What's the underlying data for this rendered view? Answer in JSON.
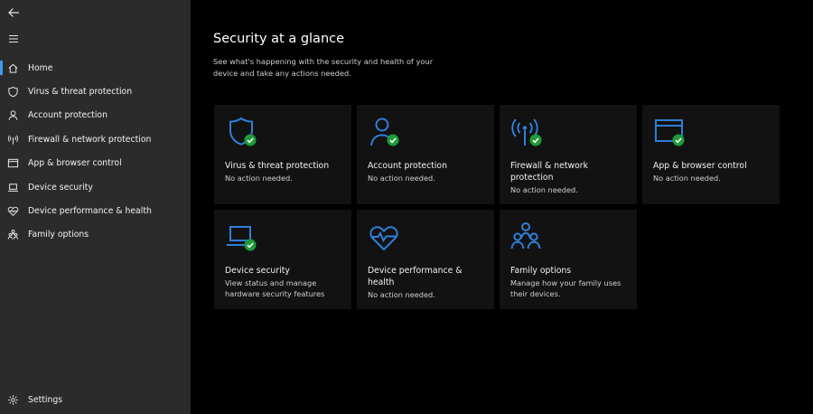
{
  "sidebar": {
    "items": [
      {
        "label": "Home",
        "icon": "home-icon",
        "active": true
      },
      {
        "label": "Virus & threat protection",
        "icon": "shield-icon"
      },
      {
        "label": "Account protection",
        "icon": "person-icon"
      },
      {
        "label": "Firewall & network protection",
        "icon": "wireless-antenna-icon"
      },
      {
        "label": "App & browser control",
        "icon": "browser-window-icon"
      },
      {
        "label": "Device security",
        "icon": "laptop-icon"
      },
      {
        "label": "Device performance & health",
        "icon": "heart-pulse-icon"
      },
      {
        "label": "Family options",
        "icon": "family-icon"
      }
    ],
    "settings_label": "Settings"
  },
  "main": {
    "title": "Security at a glance",
    "subtitle": "See what's happening with the security and health of your device and take any actions needed.",
    "tiles": [
      {
        "title": "Virus & threat protection",
        "status": "No action needed.",
        "icon": "shield-icon"
      },
      {
        "title": "Account protection",
        "status": "No action needed.",
        "icon": "person-icon"
      },
      {
        "title": "Firewall & network protection",
        "status": "No action needed.",
        "icon": "wireless-antenna-icon"
      },
      {
        "title": "App & browser control",
        "status": "No action needed.",
        "icon": "browser-window-icon"
      },
      {
        "title": "Device security",
        "status": "View status and manage hardware security features",
        "icon": "laptop-icon"
      },
      {
        "title": "Device performance & health",
        "status": "No action needed.",
        "icon": "heart-pulse-icon"
      },
      {
        "title": "Family options",
        "status": "Manage how your family uses their devices.",
        "icon": "family-icon"
      }
    ]
  },
  "colors": {
    "accent": "#3d9cf0",
    "icon_blue": "#2f7fd9",
    "check_green": "#1e9b3a",
    "sidebar_bg": "#2b2b2b",
    "tile_bg": "#121212"
  }
}
